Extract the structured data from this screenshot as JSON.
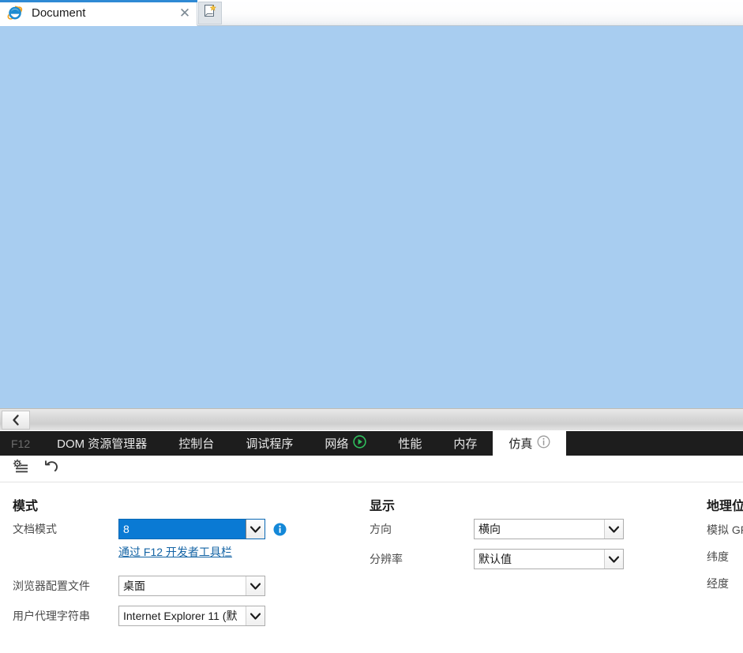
{
  "browser": {
    "tab": {
      "title": "Document",
      "favicon_icon": "ie-logo-icon",
      "close_icon": "close-icon",
      "close_glyph": "✕"
    },
    "new_tab": {
      "icon": "new-tab-page-icon",
      "label": ""
    },
    "accent_color": "#2f8ad4",
    "content_color": "#a8cdf0"
  },
  "scrollbar": {
    "left_arrow_icon": "chevron-left-icon",
    "left_arrow_glyph": "‹"
  },
  "devtools": {
    "f12_label": "F12",
    "tabs": [
      {
        "label": "DOM 资源管理器",
        "icon": "",
        "active": false
      },
      {
        "label": "控制台",
        "icon": "",
        "active": false
      },
      {
        "label": "调试程序",
        "icon": "",
        "active": false
      },
      {
        "label": "网络",
        "icon": "play-record-icon",
        "active": false
      },
      {
        "label": "性能",
        "icon": "",
        "active": false
      },
      {
        "label": "内存",
        "icon": "",
        "active": false
      },
      {
        "label": "仿真",
        "icon": "info-icon",
        "active": true
      }
    ]
  },
  "toolbar": {
    "buttons": [
      {
        "icon": "settings-list-icon",
        "label": ""
      },
      {
        "icon": "undo-reset-icon",
        "label": ""
      }
    ]
  },
  "emulation": {
    "mode": {
      "title": "模式",
      "document_mode": {
        "label": "文档模式",
        "value": "8",
        "selected": true,
        "info_icon": "info-icon",
        "sublink": "通过 F12 开发者工具栏"
      },
      "browser_profile": {
        "label": "浏览器配置文件",
        "value": "桌面"
      },
      "user_agent": {
        "label": "用户代理字符串",
        "value": "Internet Explorer 11 (默"
      }
    },
    "display": {
      "title": "显示",
      "orientation": {
        "label": "方向",
        "value": "横向"
      },
      "resolution": {
        "label": "分辨率",
        "value": "默认值"
      }
    },
    "geolocation": {
      "title": "地理位置",
      "simulate_gps": {
        "label": "模拟 GPS"
      },
      "latitude": {
        "label": "纬度"
      },
      "longitude": {
        "label": "经度"
      }
    }
  },
  "colors": {
    "accent_blue": "#0a7ad4",
    "link_blue": "#1464a5",
    "devtools_bg": "#1d1d1d",
    "page_blue": "#a8cdf0"
  }
}
